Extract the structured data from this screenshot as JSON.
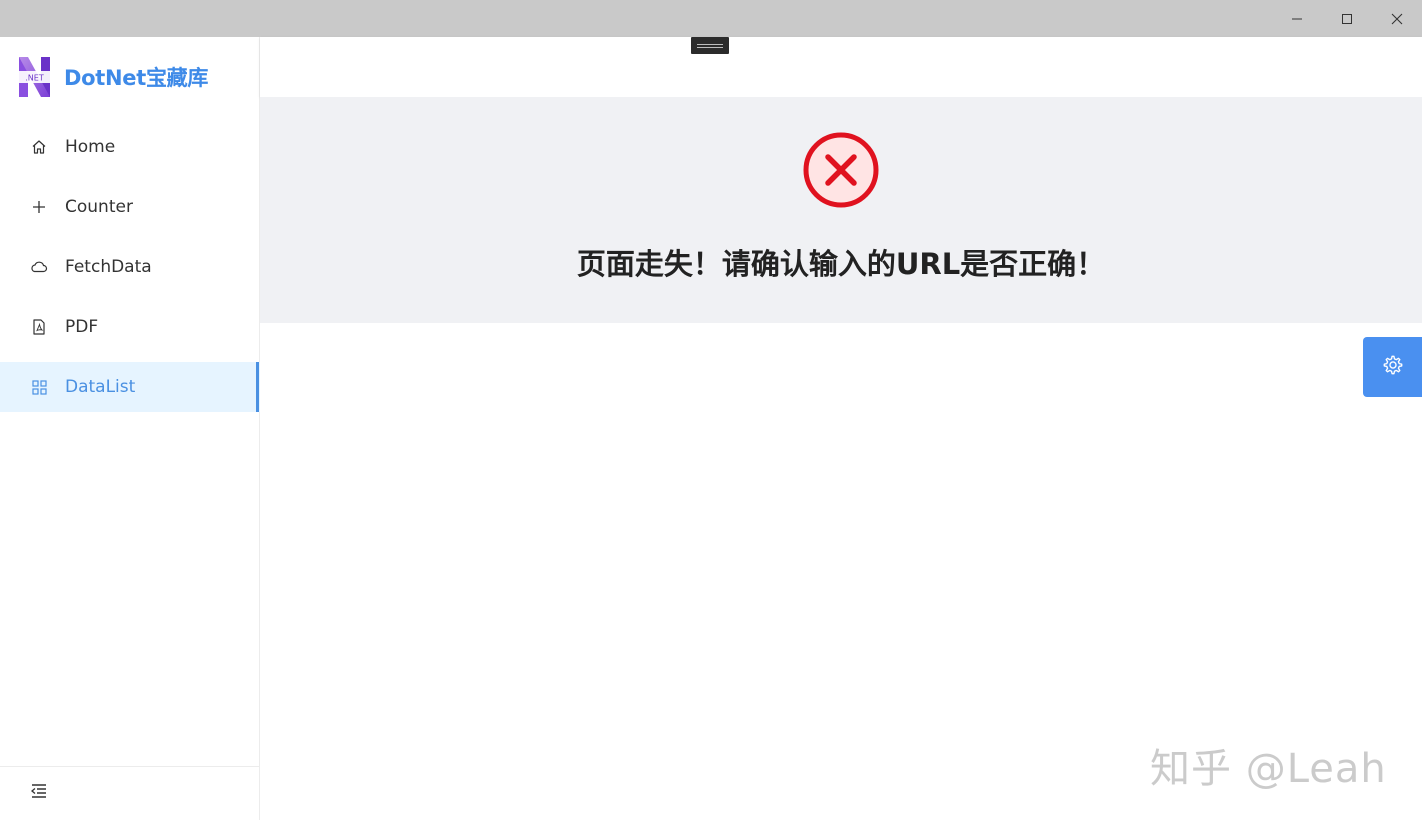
{
  "window": {
    "minimize_icon": "minimize-icon",
    "maximize_icon": "maximize-icon",
    "close_icon": "close-icon"
  },
  "brand": {
    "logo_text": ".NET",
    "title": "DotNet宝藏库",
    "logo_colors": [
      "#7b3fd6",
      "#b78be8"
    ]
  },
  "sidebar": {
    "items": [
      {
        "label": "Home",
        "icon": "home-icon"
      },
      {
        "label": "Counter",
        "icon": "plus-icon"
      },
      {
        "label": "FetchData",
        "icon": "cloud-icon"
      },
      {
        "label": "PDF",
        "icon": "pdf-file-icon"
      },
      {
        "label": "DataList",
        "icon": "grid-icon",
        "active": true
      }
    ],
    "collapse_icon": "menu-fold-icon"
  },
  "error": {
    "icon": "error-circle-icon",
    "message": "页面走失！请确认输入的URL是否正确！",
    "color": "#e0121f"
  },
  "settings_button": {
    "icon": "gear-icon"
  },
  "watermark": {
    "text": "知乎 @Leah"
  },
  "colors": {
    "accent": "#4a90e2",
    "active_bg": "#e6f4ff",
    "titlebar": "#c9c9c9",
    "panel_bg": "#f0f1f4"
  }
}
